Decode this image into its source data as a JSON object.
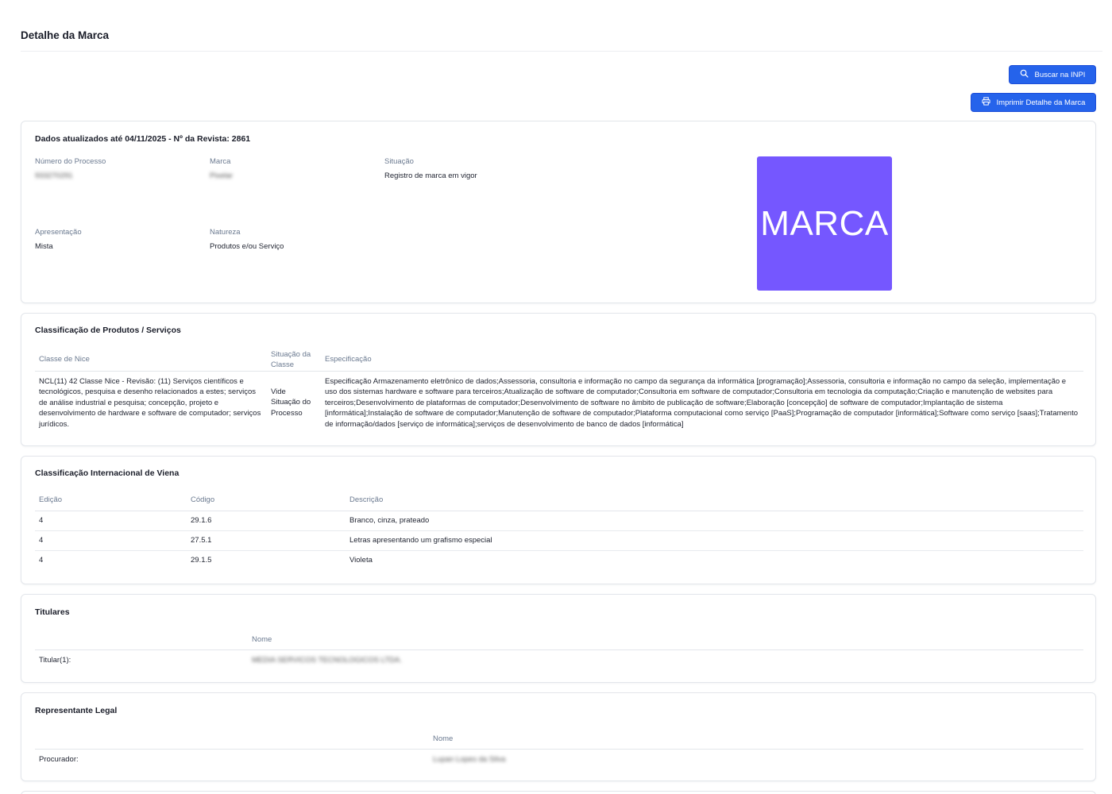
{
  "page": {
    "title": "Detalhe da Marca"
  },
  "actions": {
    "search_label": "Buscar na INPI",
    "search_icon": "search-icon",
    "print_label": "Imprimir Detalhe da Marca",
    "print_icon": "printer-icon",
    "accent_color": "#2563eb"
  },
  "dados": {
    "title": "Dados atualizados até 04/11/2025 - Nº da Revista: 2861",
    "numero_processo_label": "Número do Processo",
    "numero_processo_value": "933270291",
    "marca_label": "Marca",
    "marca_value": "Pixelar",
    "situacao_label": "Situação",
    "situacao_value": "Registro de marca em vigor",
    "apresentacao_label": "Apresentação",
    "apresentacao_value": "Mista",
    "natureza_label": "Natureza",
    "natureza_value": "Produtos e/ou Serviço",
    "brand_image_text": "MARCA",
    "brand_image_color": "#7557ff"
  },
  "nice": {
    "title": "Classificação de Produtos / Serviços",
    "headers": {
      "classe": "Classe de Nice",
      "situacao": "Situação da Classe",
      "especificacao": "Especificação"
    },
    "rows": [
      {
        "classe": "NCL(11) 42 Classe Nice - Revisão: (11) Serviços científicos e tecnológicos, pesquisa e desenho relacionados a estes; serviços de análise industrial e pesquisa; concepção, projeto e desenvolvimento de hardware e software de computador; serviços jurídicos.",
        "situacao": "Vide Situação do Processo",
        "especificacao": "Especificação Armazenamento eletrônico de dados;Assessoria, consultoria e informação no campo da segurança da informática [programação];Assessoria, consultoria e informação no campo da seleção, implementação e uso dos sistemas hardware e software para terceiros;Atualização de software de computador;Consultoria em software de computador;Consultoria em tecnologia da computação;Criação e manutenção de websites para terceiros;Desenvolvimento de plataformas de computador;Desenvolvimento de software no âmbito de publicação de software;Elaboração [concepção] de software de computador;Implantação de sistema [informática];Instalação de software de computador;Manutenção de software de computador;Plataforma computacional como serviço [PaaS];Programação de computador [informática];Software como serviço [saas];Tratamento de informação/dados [serviço de informática];serviços de desenvolvimento de banco de dados [informática]"
      }
    ]
  },
  "viena": {
    "title": "Classificação Internacional de Viena",
    "headers": {
      "edicao": "Edição",
      "codigo": "Código",
      "descricao": "Descrição"
    },
    "rows": [
      {
        "edicao": "4",
        "codigo": "29.1.6",
        "descricao": "Branco, cinza, prateado"
      },
      {
        "edicao": "4",
        "codigo": "27.5.1",
        "descricao": "Letras apresentando um grafismo especial"
      },
      {
        "edicao": "4",
        "codigo": "29.1.5",
        "descricao": "Violeta"
      }
    ]
  },
  "titulares": {
    "title": "Titulares",
    "nome_header": "Nome",
    "row_label": "Titular(1):",
    "row_value": "MEDIA SERVICOS TECNOLOGICOS LTDA."
  },
  "representante": {
    "title": "Representante Legal",
    "nome_header": "Nome",
    "row_label": "Procurador:",
    "row_value": "Lupan Lopes da Silva"
  }
}
